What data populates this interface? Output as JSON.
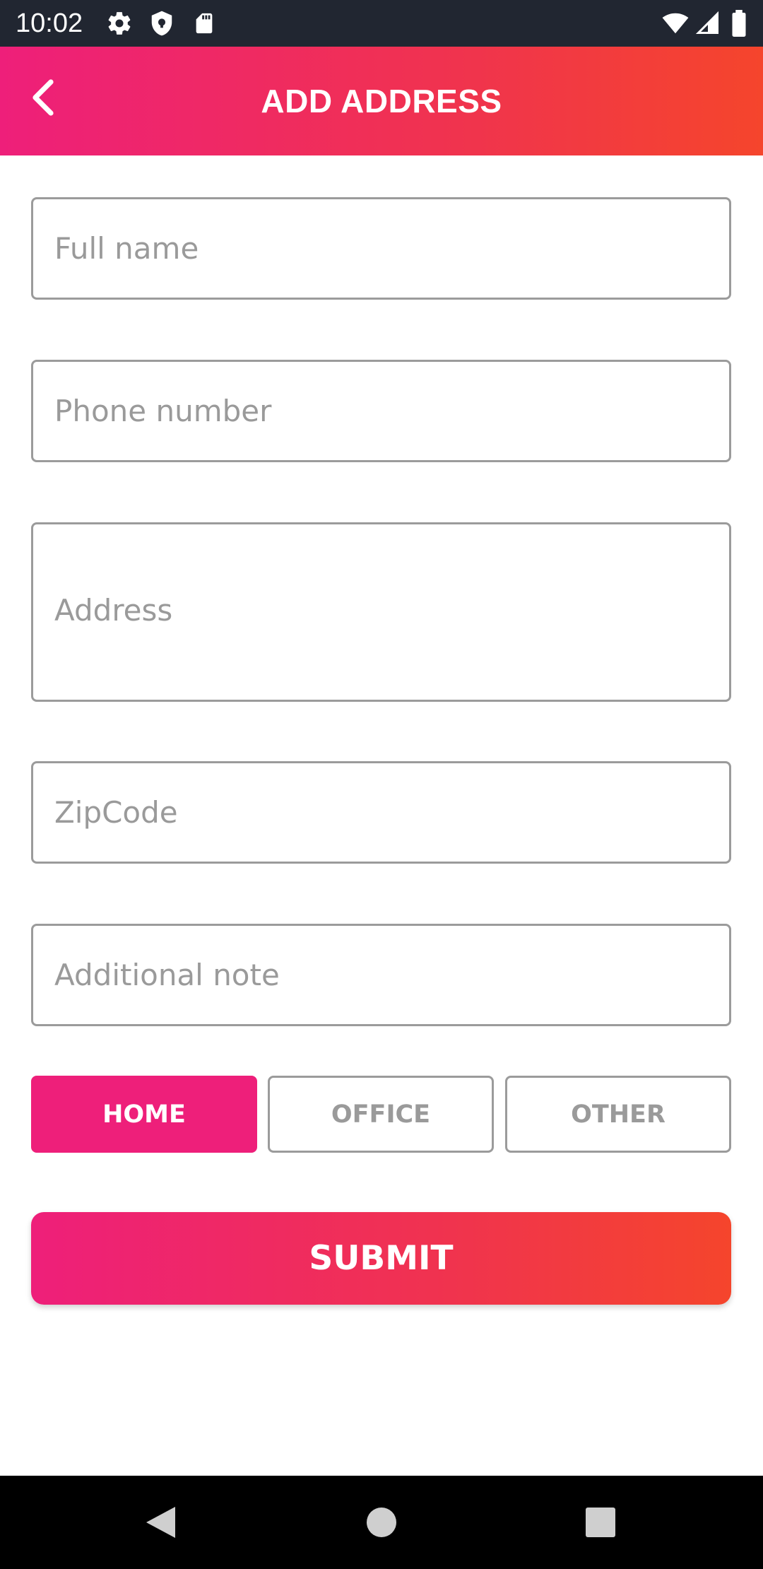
{
  "status_bar": {
    "time": "10:02",
    "left_icons": [
      "gear-icon",
      "shield-icon",
      "sd-card-icon"
    ],
    "right_icons": [
      "wifi-icon",
      "cell-signal-icon",
      "battery-icon"
    ]
  },
  "app_bar": {
    "title": "ADD ADDRESS",
    "back_icon": "chevron-left-icon"
  },
  "form": {
    "full_name": {
      "placeholder": "Full name",
      "value": ""
    },
    "phone": {
      "placeholder": "Phone number",
      "value": ""
    },
    "address": {
      "placeholder": "Address",
      "value": ""
    },
    "zipcode": {
      "placeholder": "ZipCode",
      "value": ""
    },
    "note": {
      "placeholder": "Additional note",
      "value": ""
    }
  },
  "address_type": {
    "options": [
      "HOME",
      "OFFICE",
      "OTHER"
    ],
    "selected": "HOME"
  },
  "submit_label": "SUBMIT",
  "nav_bar": {
    "icons": [
      "back-triangle-icon",
      "home-circle-icon",
      "recents-square-icon"
    ]
  },
  "colors": {
    "accent": "#ee1f7a",
    "gradient_start": "#ee1f7a",
    "gradient_end": "#f5452c",
    "status_bar": "#212631",
    "border": "#9b9b9b",
    "placeholder": "#9a9a9a"
  }
}
